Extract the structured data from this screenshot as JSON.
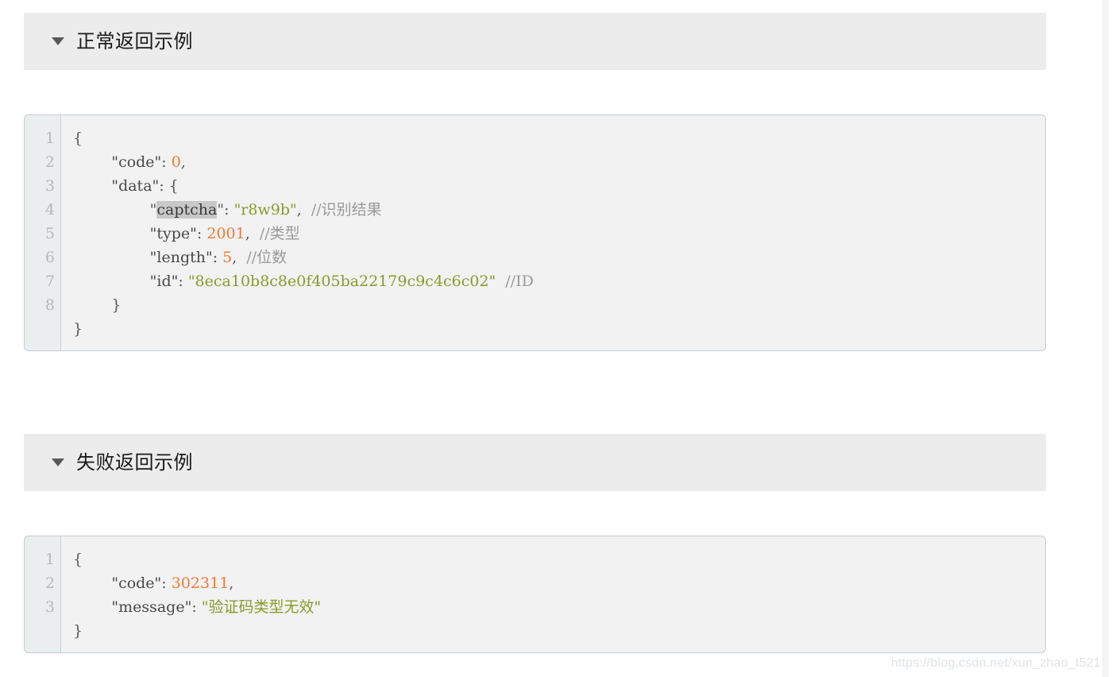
{
  "sections": [
    {
      "caret": "caret-down-icon",
      "title": "正常返回示例",
      "code": {
        "line_numbers": [
          "1",
          "2",
          "3",
          "4",
          "5",
          "6",
          "7",
          "8"
        ],
        "lines": [
          {
            "n": "1",
            "indent": 0,
            "parts": [
              {
                "t": "punct",
                "v": "{"
              }
            ]
          },
          {
            "n": "2",
            "indent": 1,
            "parts": [
              {
                "t": "key",
                "v": "\"code\""
              },
              {
                "t": "punct",
                "v": ": "
              },
              {
                "t": "num",
                "v": "0"
              },
              {
                "t": "punct",
                "v": ","
              }
            ]
          },
          {
            "n": "3",
            "indent": 1,
            "parts": [
              {
                "t": "key",
                "v": "\"data\""
              },
              {
                "t": "punct",
                "v": ": {"
              }
            ]
          },
          {
            "n": "4",
            "indent": 2,
            "parts": [
              {
                "t": "punct",
                "v": "\""
              },
              {
                "t": "sel",
                "v": "captcha"
              },
              {
                "t": "punct",
                "v": "\": "
              },
              {
                "t": "str",
                "v": "\"r8w9b\""
              },
              {
                "t": "punct",
                "v": ","
              },
              {
                "t": "comment",
                "v": "  //识别结果"
              }
            ]
          },
          {
            "n": "5",
            "indent": 2,
            "parts": [
              {
                "t": "key",
                "v": "\"type\""
              },
              {
                "t": "punct",
                "v": ": "
              },
              {
                "t": "num",
                "v": "2001"
              },
              {
                "t": "punct",
                "v": ","
              },
              {
                "t": "comment",
                "v": "  //类型"
              }
            ]
          },
          {
            "n": "6",
            "indent": 2,
            "parts": [
              {
                "t": "key",
                "v": "\"length\""
              },
              {
                "t": "punct",
                "v": ": "
              },
              {
                "t": "num",
                "v": "5"
              },
              {
                "t": "punct",
                "v": ","
              },
              {
                "t": "comment",
                "v": "  //位数"
              }
            ]
          },
          {
            "n": "7",
            "indent": 2,
            "parts": [
              {
                "t": "key",
                "v": "\"id\""
              },
              {
                "t": "punct",
                "v": ": "
              },
              {
                "t": "str",
                "v": "\"8eca10b8c8e0f405ba22179c9c4c6c02\""
              },
              {
                "t": "comment",
                "v": "  //ID"
              }
            ]
          },
          {
            "n": "8",
            "indent": 1,
            "parts": [
              {
                "t": "punct",
                "v": "}"
              }
            ]
          },
          {
            "n": "",
            "indent": 0,
            "parts": [
              {
                "t": "punct",
                "v": "}"
              }
            ]
          }
        ]
      }
    },
    {
      "caret": "caret-down-icon",
      "title": "失败返回示例",
      "code": {
        "line_numbers": [
          "1",
          "2",
          "3"
        ],
        "lines": [
          {
            "n": "1",
            "indent": 0,
            "parts": [
              {
                "t": "punct",
                "v": "{"
              }
            ]
          },
          {
            "n": "2",
            "indent": 1,
            "parts": [
              {
                "t": "key",
                "v": "\"code\""
              },
              {
                "t": "punct",
                "v": ": "
              },
              {
                "t": "num",
                "v": "302311"
              },
              {
                "t": "punct",
                "v": ","
              }
            ]
          },
          {
            "n": "3",
            "indent": 1,
            "parts": [
              {
                "t": "key",
                "v": "\"message\""
              },
              {
                "t": "punct",
                "v": ": "
              },
              {
                "t": "str",
                "v": "\"验证码类型无效\""
              }
            ]
          },
          {
            "n": "",
            "indent": 0,
            "parts": [
              {
                "t": "punct",
                "v": "}"
              }
            ]
          }
        ]
      }
    }
  ],
  "watermark": "https://blog.csdn.net/xun_zhao_t521",
  "colors": {
    "header_bg": "#ececec",
    "code_bg": "#f2f2f2",
    "gutter_bg": "#ebeeee",
    "border": "#c3ccd1",
    "number_token": "#f07a33",
    "string_token": "#8a9a2b",
    "comment_token": "#9a9a9a",
    "selection": "#c8c8c8",
    "watermark": "#dfe3e8"
  }
}
